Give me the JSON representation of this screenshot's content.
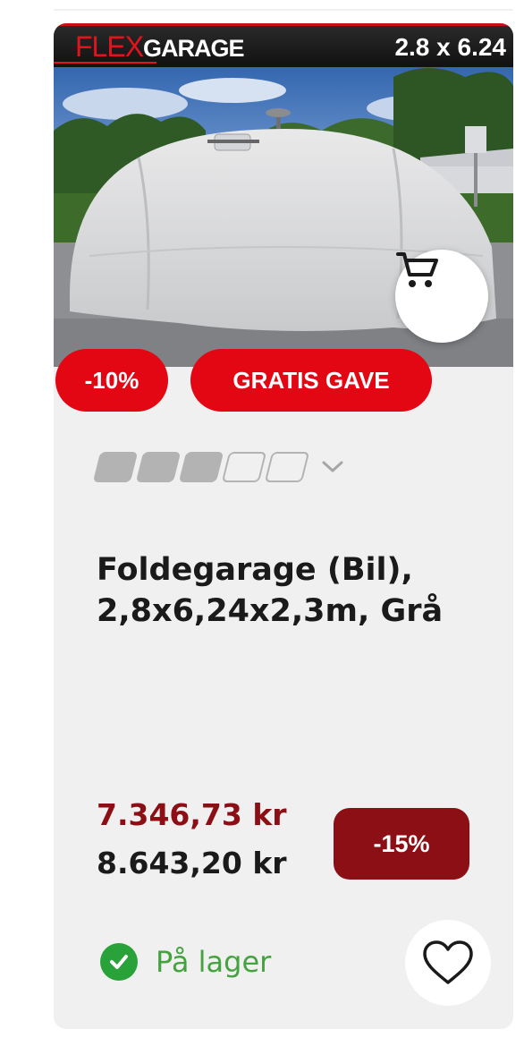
{
  "product": {
    "brand_part1": "FLEX",
    "brand_part2": "GARAGE",
    "size_label": "2.8 x 6.24",
    "badges": {
      "discount": "-10%",
      "gift": "GRATIS GAVE"
    },
    "rating": {
      "filled": 3,
      "total": 5
    },
    "title_line1": "Foldegarage (Bil),",
    "title_line2": "2,8x6,24x2,3m, Grå",
    "price_current": "7.346,73 kr",
    "price_previous": "8.643,20 kr",
    "price_discount": "-15%",
    "stock_status": "På lager"
  },
  "icons": {
    "cart": "shopping-cart-icon",
    "rating_toggle": "chevron-down-icon",
    "stock": "check-circle-icon",
    "favorite": "heart-icon"
  },
  "colors": {
    "badge_red": "#e30613",
    "price_red": "#8b0f15",
    "stock_green": "#2aa23a"
  }
}
